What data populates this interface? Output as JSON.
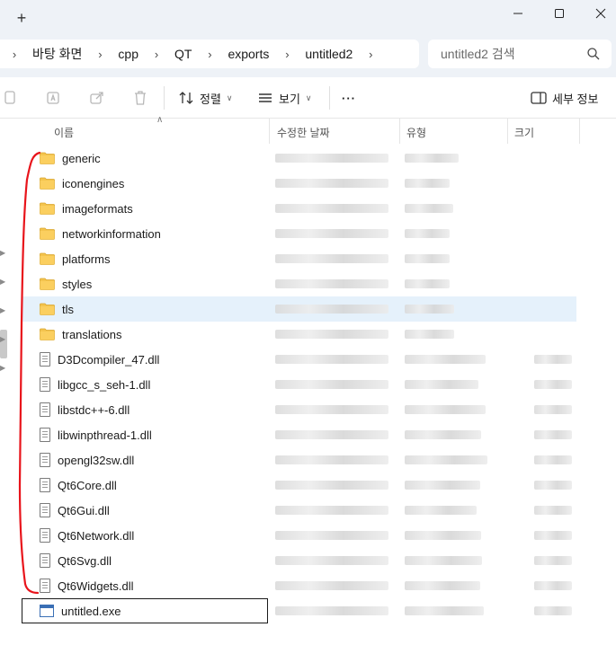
{
  "window": {
    "new_tab_glyph": "+",
    "minimize_icon": "minimize-icon",
    "maximize_icon": "maximize-icon",
    "close_icon": "close-icon"
  },
  "breadcrumb": {
    "items": [
      "바탕 화면",
      "cpp",
      "QT",
      "exports",
      "untitled2"
    ]
  },
  "search": {
    "placeholder": "untitled2 검색",
    "icon": "search-icon"
  },
  "commandbar": {
    "sort_label": "정렬",
    "view_label": "보기",
    "more_label": "···",
    "details_label": "세부 정보"
  },
  "columns": {
    "name": "이름",
    "date": "수정한 날짜",
    "type": "유형",
    "size": "크기"
  },
  "files": [
    {
      "name": "generic",
      "kind": "folder"
    },
    {
      "name": "iconengines",
      "kind": "folder"
    },
    {
      "name": "imageformats",
      "kind": "folder"
    },
    {
      "name": "networkinformation",
      "kind": "folder"
    },
    {
      "name": "platforms",
      "kind": "folder"
    },
    {
      "name": "styles",
      "kind": "folder"
    },
    {
      "name": "tls",
      "kind": "folder",
      "selected": true
    },
    {
      "name": "translations",
      "kind": "folder"
    },
    {
      "name": "D3Dcompiler_47.dll",
      "kind": "dll"
    },
    {
      "name": "libgcc_s_seh-1.dll",
      "kind": "dll"
    },
    {
      "name": "libstdc++-6.dll",
      "kind": "dll"
    },
    {
      "name": "libwinpthread-1.dll",
      "kind": "dll"
    },
    {
      "name": "opengl32sw.dll",
      "kind": "dll"
    },
    {
      "name": "Qt6Core.dll",
      "kind": "dll"
    },
    {
      "name": "Qt6Gui.dll",
      "kind": "dll"
    },
    {
      "name": "Qt6Network.dll",
      "kind": "dll"
    },
    {
      "name": "Qt6Svg.dll",
      "kind": "dll"
    },
    {
      "name": "Qt6Widgets.dll",
      "kind": "dll"
    },
    {
      "name": "untitled.exe",
      "kind": "exe",
      "focused": true
    }
  ],
  "colors": {
    "accent_selection": "#e5f1fb",
    "folder": "#f4c44e",
    "annotation": "#e8141b"
  }
}
